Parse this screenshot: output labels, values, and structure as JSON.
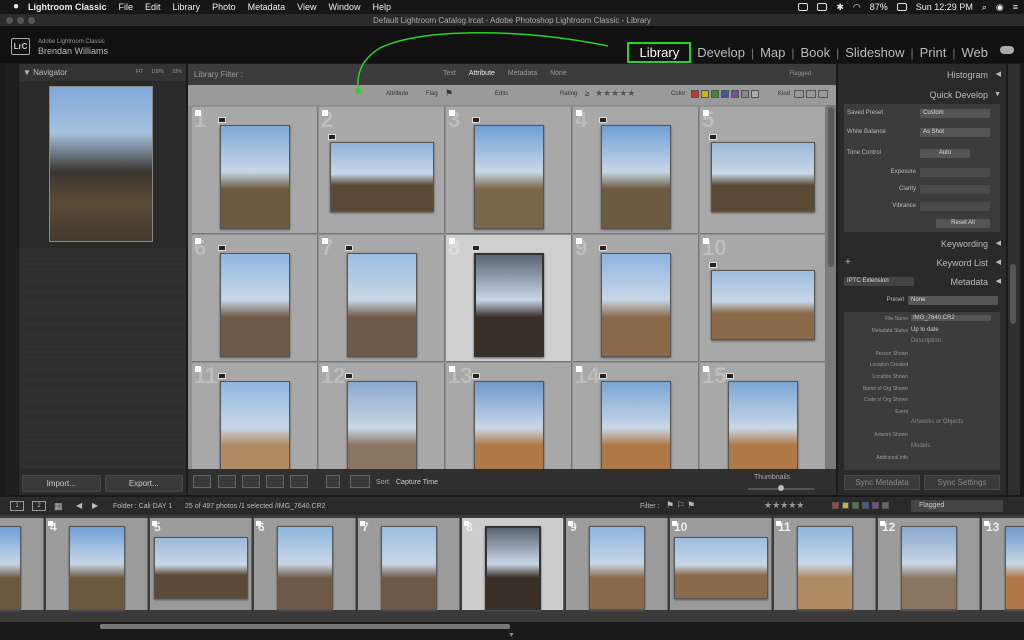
{
  "menubar": {
    "items": [
      "Lightroom Classic",
      "File",
      "Edit",
      "Library",
      "Photo",
      "Metadata",
      "View",
      "Window",
      "Help"
    ],
    "battery": "87%",
    "clock": "Sun 12:29 PM"
  },
  "titlebar": {
    "title": "Default Lightroom Catalog.lrcat - Adobe Photoshop Lightroom Classic - Library"
  },
  "identity": {
    "logo": "LrC",
    "product": "Adobe Lightroom Classic",
    "user": "Brendan Williams"
  },
  "modules": {
    "items": [
      "Library",
      "Develop",
      "Map",
      "Book",
      "Slideshow",
      "Print",
      "Web"
    ],
    "active": "Library"
  },
  "colors": {
    "highlight": "#26d32b",
    "panel": "#2a2a2a",
    "grid": "#a8a8a8"
  },
  "left_panel": {
    "navigator_title": "Navigator",
    "zoom_levels": [
      "FIT",
      "100%",
      "33%"
    ],
    "import_label": "Import...",
    "export_label": "Export..."
  },
  "filter_bar": {
    "label": "Library Filter :",
    "tabs": [
      "Text",
      "Attribute",
      "Metadata",
      "None"
    ],
    "active_tab": "Attribute",
    "preset": "Flagged"
  },
  "attribute_bar": {
    "attribute": "Attribute",
    "flag": "Flag",
    "edits": "Edits",
    "rating": "Rating",
    "rating_op": "≥",
    "stars": "★★★★★",
    "color": "Color",
    "kind": "Kind",
    "label_colors": [
      "#c0392b",
      "#d4b020",
      "#3a8a3a",
      "#3a5aa8",
      "#7a4aa0",
      "#888888",
      "#aaaaaa"
    ]
  },
  "grid": {
    "numbers": [
      "1",
      "2",
      "3",
      "4",
      "5",
      "6",
      "7",
      "8",
      "9",
      "10",
      "11",
      "12",
      "13",
      "14",
      "15"
    ],
    "selected_index": 7
  },
  "toolbar": {
    "sort_label": "Sort:",
    "sort_value": "Capture Time",
    "thumbnails_label": "Thumbnails"
  },
  "right_panel": {
    "histogram": "Histogram",
    "quick_develop": "Quick Develop",
    "saved_preset_label": "Saved Preset",
    "saved_preset_value": "Custom",
    "white_balance_label": "White Balance",
    "white_balance_value": "As Shot",
    "tone_control_label": "Tone Control",
    "auto_label": "Auto",
    "exposure_label": "Exposure",
    "clarity_label": "Clarity",
    "vibrance_label": "Vibrance",
    "reset_all_label": "Reset All",
    "keywording": "Keywording",
    "keyword_list": "Keyword List",
    "add_symbol": "+",
    "metadata_set": "IPTC Extension",
    "metadata": "Metadata",
    "preset_label": "Preset",
    "preset_value": "None",
    "fields": [
      {
        "label": "File Name",
        "value": "IMG_7640.CR2"
      },
      {
        "label": "Metadata Status",
        "value": "Up to date"
      },
      {
        "label": "",
        "value": "Description"
      },
      {
        "label": "Person Shown",
        "value": ""
      },
      {
        "label": "Location Created",
        "value": ""
      },
      {
        "label": "Location Shown",
        "value": ""
      },
      {
        "label": "Name of Org Shown",
        "value": ""
      },
      {
        "label": "Code of Org Shown",
        "value": ""
      },
      {
        "label": "Event",
        "value": ""
      },
      {
        "label": "",
        "value": "Artworks or Objects"
      },
      {
        "label": "Artwork Shown",
        "value": ""
      },
      {
        "label": "",
        "value": "Models"
      },
      {
        "label": "Additional Info",
        "value": ""
      }
    ],
    "sync_metadata": "Sync Metadata",
    "sync_settings": "Sync Settings"
  },
  "filmstrip_bar": {
    "page1": "1",
    "page2": "2",
    "folder": "Folder : Cali DAY 1",
    "count": "25 of 497 photos /1 selected /IMG_7640.CR2",
    "filter_label": "Filter :",
    "flagged": "Flagged"
  },
  "filmstrip": {
    "numbers": [
      "",
      "4",
      "5",
      "6",
      "7",
      "8",
      "9",
      "10",
      "11",
      "12",
      "13"
    ],
    "selected_index": 5
  }
}
